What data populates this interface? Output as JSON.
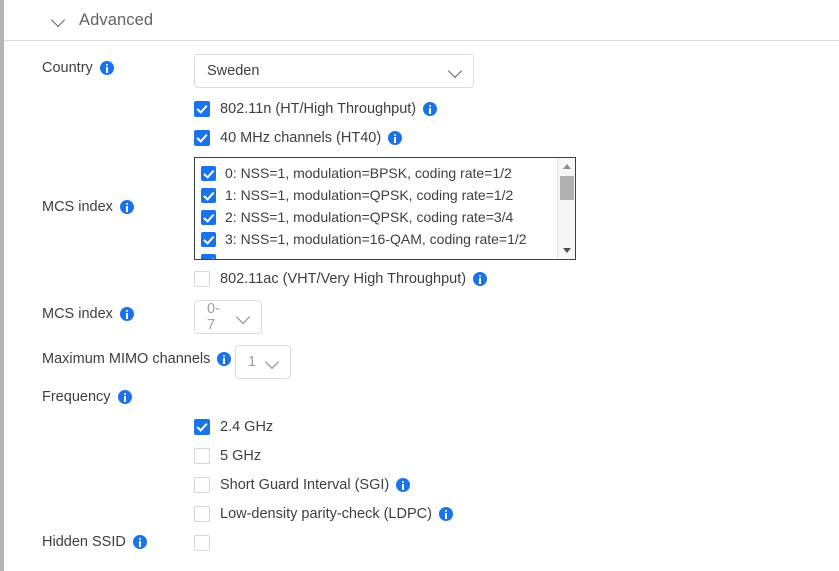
{
  "section": {
    "title": "Advanced",
    "collapse_icon": "chevron-down-icon"
  },
  "country": {
    "label": "Country",
    "info_icon": "info-icon",
    "value": "Sweden",
    "caret_icon": "chevron-down-icon"
  },
  "ht": {
    "n_label": "802.11n (HT/High Throughput)",
    "n_checked": true,
    "ht40_label": "40 MHz channels (HT40)",
    "ht40_checked": true
  },
  "mcs_list": {
    "label": "MCS index",
    "info_icon": "info-icon",
    "items": [
      {
        "label": "0: NSS=1, modulation=BPSK, coding rate=1/2",
        "checked": true
      },
      {
        "label": "1: NSS=1, modulation=QPSK, coding rate=1/2",
        "checked": true
      },
      {
        "label": "2: NSS=1, modulation=QPSK, coding rate=3/4",
        "checked": true
      },
      {
        "label": "3: NSS=1, modulation=16-QAM, coding rate=1/2",
        "checked": true
      }
    ],
    "scroll_up_icon": "scroll-up-arrow-icon",
    "scroll_down_icon": "scroll-down-arrow-icon"
  },
  "vht": {
    "label": "802.11ac (VHT/Very High Throughput)",
    "checked": false
  },
  "mcs_select": {
    "label": "MCS index",
    "value": "0-7",
    "disabled": true
  },
  "mimo": {
    "label": "Maximum MIMO channels",
    "value": "1",
    "disabled": true
  },
  "frequency": {
    "label": "Frequency",
    "options": [
      {
        "label": "2.4 GHz",
        "checked": true,
        "info": false
      },
      {
        "label": "5 GHz",
        "checked": false,
        "info": false
      },
      {
        "label": "Short Guard Interval (SGI)",
        "checked": false,
        "info": true
      },
      {
        "label": "Low-density parity-check (LDPC)",
        "checked": false,
        "info": true
      }
    ]
  },
  "hidden_ssid": {
    "label": "Hidden SSID",
    "checked": false
  },
  "colors": {
    "accent": "#1a73e8",
    "text": "#3c4043",
    "muted": "#5f6368",
    "border": "#dadce0"
  }
}
